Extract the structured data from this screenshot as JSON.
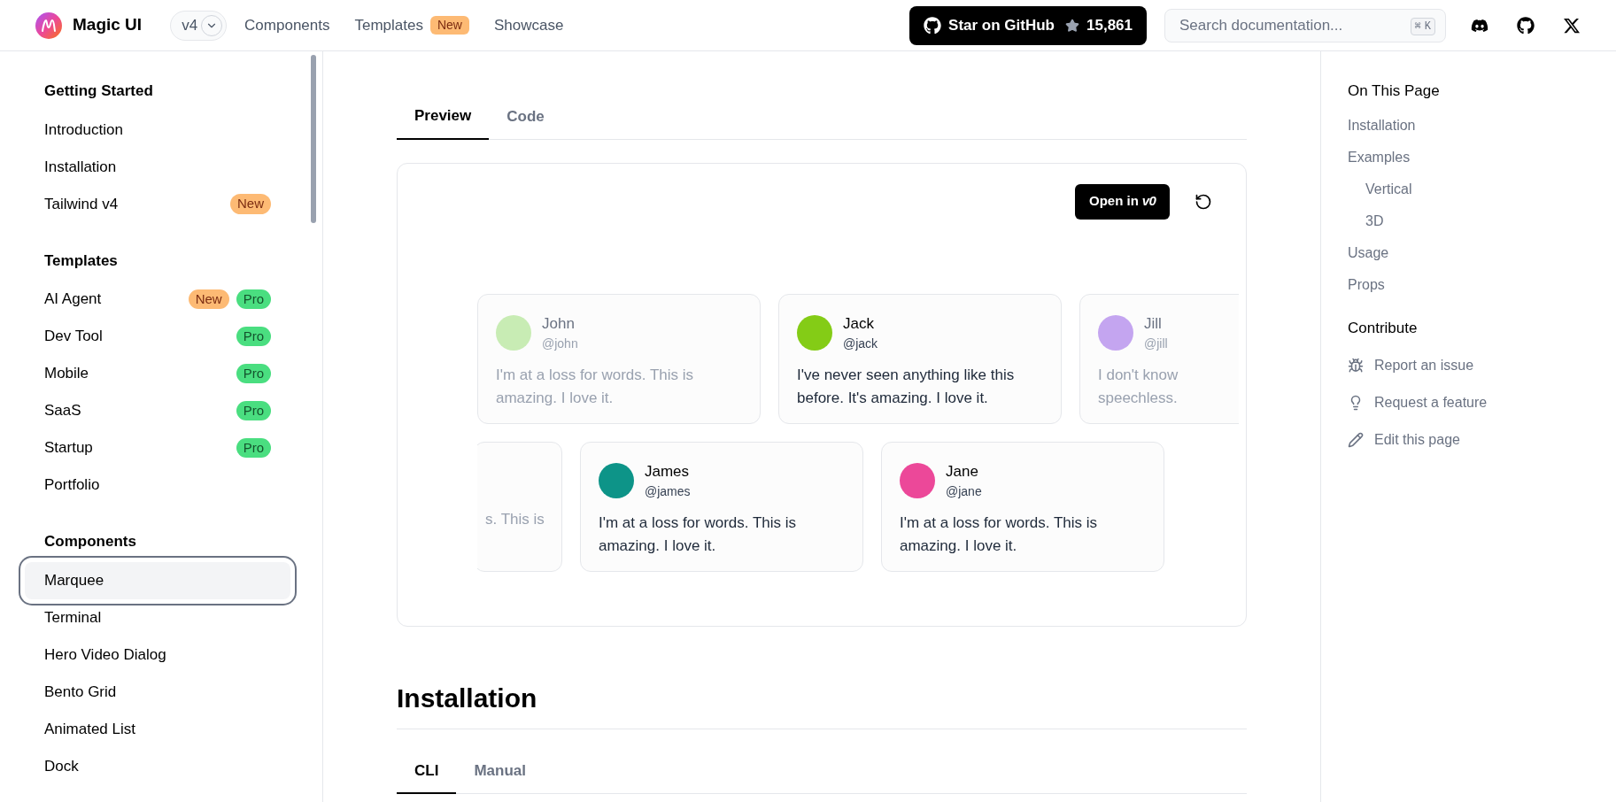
{
  "header": {
    "brand": "Magic UI",
    "version": "v4",
    "nav": [
      {
        "label": "Components"
      },
      {
        "label": "Templates",
        "badge": "New"
      },
      {
        "label": "Showcase"
      }
    ],
    "github": {
      "label": "Star on GitHub",
      "count": "15,861"
    },
    "search": {
      "placeholder": "Search documentation...",
      "keys": [
        "⌘",
        "K"
      ]
    }
  },
  "sidebar": {
    "sections": [
      {
        "title": "Getting Started",
        "items": [
          {
            "label": "Introduction",
            "selected": false
          },
          {
            "label": "Installation",
            "selected": false
          },
          {
            "label": "Tailwind v4",
            "selected": false,
            "badges": [
              {
                "label": "New",
                "kind": "new"
              }
            ]
          }
        ]
      },
      {
        "title": "Templates",
        "items": [
          {
            "label": "AI Agent",
            "selected": false,
            "badges": [
              {
                "label": "New",
                "kind": "new"
              },
              {
                "label": "Pro",
                "kind": "pro"
              }
            ]
          },
          {
            "label": "Dev Tool",
            "selected": false,
            "badges": [
              {
                "label": "Pro",
                "kind": "pro"
              }
            ]
          },
          {
            "label": "Mobile",
            "selected": false,
            "badges": [
              {
                "label": "Pro",
                "kind": "pro"
              }
            ]
          },
          {
            "label": "SaaS",
            "selected": false,
            "badges": [
              {
                "label": "Pro",
                "kind": "pro"
              }
            ]
          },
          {
            "label": "Startup",
            "selected": false,
            "badges": [
              {
                "label": "Pro",
                "kind": "pro"
              }
            ]
          },
          {
            "label": "Portfolio",
            "selected": false
          }
        ]
      },
      {
        "title": "Components",
        "items": [
          {
            "label": "Marquee",
            "selected": true
          },
          {
            "label": "Terminal",
            "selected": false
          },
          {
            "label": "Hero Video Dialog",
            "selected": false
          },
          {
            "label": "Bento Grid",
            "selected": false
          },
          {
            "label": "Animated List",
            "selected": false
          },
          {
            "label": "Dock",
            "selected": false
          }
        ]
      }
    ]
  },
  "main": {
    "tabs": [
      {
        "label": "Preview",
        "selected": true
      },
      {
        "label": "Code",
        "selected": false
      }
    ],
    "preview": {
      "open_button": {
        "label": "Open in",
        "logo": "v0"
      },
      "rows": [
        [
          {
            "name": "John",
            "handle": "@john",
            "text": "I'm at a loss for words. This is amazing. I love it.",
            "faded": true,
            "color": "#c8ecb4"
          },
          {
            "name": "Jack",
            "handle": "@jack",
            "text": "I've never seen anything like this before. It's amazing. I love it.",
            "faded": false,
            "color": "#84cc16"
          },
          {
            "name": "Jill",
            "handle": "@jill",
            "text": "I don't know\nspeechless.",
            "faded": true,
            "color": "#c4a5f0"
          }
        ],
        [
          {
            "text": "s. This is",
            "faded": true
          },
          {
            "name": "James",
            "handle": "@james",
            "text": "I'm at a loss for words. This is amazing. I love it.",
            "faded": false,
            "color": "#0d9488"
          },
          {
            "name": "Jane",
            "handle": "@jane",
            "text": "I'm at a loss for words. This is amazing. I love it.",
            "faded": false,
            "color": "#ec4899"
          }
        ]
      ]
    },
    "section_title": "Installation",
    "install_tabs": [
      {
        "label": "CLI",
        "selected": true
      },
      {
        "label": "Manual",
        "selected": false
      }
    ]
  },
  "toc": {
    "title": "On This Page",
    "items": [
      {
        "label": "Installation"
      },
      {
        "label": "Examples",
        "children": [
          {
            "label": "Vertical"
          },
          {
            "label": "3D"
          }
        ]
      },
      {
        "label": "Usage"
      },
      {
        "label": "Props"
      }
    ],
    "contribute_title": "Contribute",
    "links": [
      {
        "label": "Report an issue",
        "kind": "bug"
      },
      {
        "label": "Request a feature",
        "kind": "idea"
      },
      {
        "label": "Edit this page",
        "kind": "edit"
      }
    ]
  }
}
